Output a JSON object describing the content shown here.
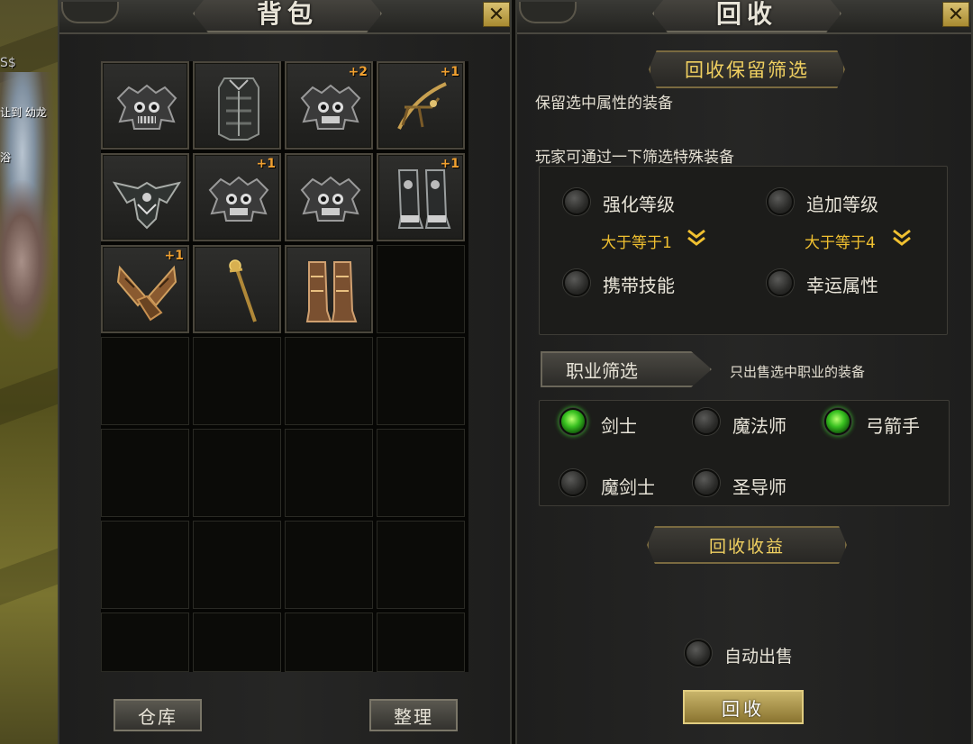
{
  "background": {
    "text_lines": [
      "S$",
      "让到 幼龙",
      "浴"
    ]
  },
  "bag": {
    "title": "背包",
    "close_label": "✕",
    "items": [
      {
        "name": "skull-armor-icon",
        "level": ""
      },
      {
        "name": "dark-chestplate-icon",
        "level": ""
      },
      {
        "name": "skull-armor-icon",
        "level": "+2"
      },
      {
        "name": "golden-bow-icon",
        "level": "+1"
      },
      {
        "name": "winged-armor-icon",
        "level": ""
      },
      {
        "name": "skull-armor-icon",
        "level": "+1"
      },
      {
        "name": "skull-armor-icon",
        "level": ""
      },
      {
        "name": "steel-boots-icon",
        "level": "+1"
      },
      {
        "name": "leather-gloves-icon",
        "level": "+1"
      },
      {
        "name": "golden-staff-icon",
        "level": ""
      },
      {
        "name": "bronze-boots-icon",
        "level": ""
      }
    ],
    "warehouse_button": "仓库",
    "sort_button": "整理"
  },
  "recycle": {
    "title": "回收",
    "close_label": "✕",
    "filter_title": "回收保留筛选",
    "keep_desc": "保留选中属性的装备",
    "special_desc": "玩家可通过一下筛选特殊装备",
    "options": {
      "enhance_label": "强化等级",
      "enhance_value": "大于等于1",
      "extra_label": "追加等级",
      "extra_value": "大于等于4",
      "skill_label": "携带技能",
      "luck_label": "幸运属性"
    },
    "job_tab": "职业筛选",
    "job_desc": "只出售选中职业的装备",
    "jobs": {
      "swordsman": "剑士",
      "mage": "魔法师",
      "archer": "弓箭手",
      "magic_swordsman": "魔剑士",
      "saint": "圣导师"
    },
    "income_title": "回收收益",
    "auto_sell_label": "自动出售",
    "recycle_button": "回收",
    "colors": {
      "gold": "#f0c030",
      "level_orange": "#f0a030",
      "radio_on": "#38c020"
    }
  }
}
